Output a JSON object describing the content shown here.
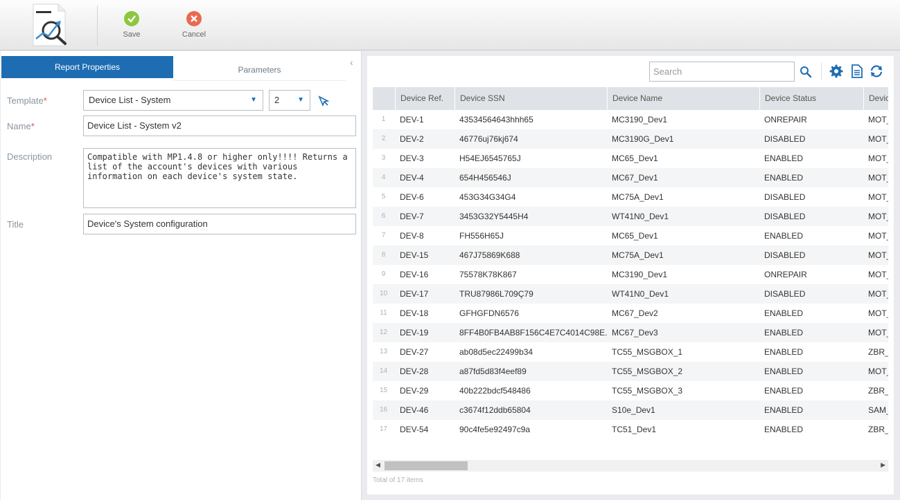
{
  "toolbar": {
    "save_label": "Save",
    "cancel_label": "Cancel",
    "save_color": "#8dc63f",
    "cancel_color": "#e76b51"
  },
  "tabs": {
    "report_properties": "Report Properties",
    "parameters": "Parameters"
  },
  "form": {
    "template_label": "Template",
    "template_value": "Device List - System",
    "version_value": "2",
    "name_label": "Name",
    "name_value": "Device List - System v2",
    "description_label": "Description",
    "description_value": "Compatible with MP1.4.8 or higher only!!!! Returns a list of the account's devices with various information on each device's system state.",
    "title_label": "Title",
    "title_value": "Device's System configuration",
    "required_mark": "*"
  },
  "search": {
    "placeholder": "Search"
  },
  "grid": {
    "columns": [
      "Device Ref.",
      "Device SSN",
      "Device Name",
      "Device Status",
      "Devic"
    ],
    "rows": [
      {
        "n": "1",
        "ref": "DEV-1",
        "ssn": "43534564643hhh65",
        "name": "MC3190_Dev1",
        "status": "ONREPAIR",
        "extra": "MOT_"
      },
      {
        "n": "2",
        "ref": "DEV-2",
        "ssn": "46776uj76kj674",
        "name": "MC3190G_Dev1",
        "status": "DISABLED",
        "extra": "MOT_"
      },
      {
        "n": "3",
        "ref": "DEV-3",
        "ssn": "H54EJ6545765J",
        "name": "MC65_Dev1",
        "status": "ENABLED",
        "extra": "MOT_"
      },
      {
        "n": "4",
        "ref": "DEV-4",
        "ssn": "654H456546J",
        "name": "MC67_Dev1",
        "status": "ENABLED",
        "extra": "MOT_"
      },
      {
        "n": "5",
        "ref": "DEV-6",
        "ssn": "453G34G34G4",
        "name": "MC75A_Dev1",
        "status": "DISABLED",
        "extra": "MOT_"
      },
      {
        "n": "6",
        "ref": "DEV-7",
        "ssn": "3453G32Y5445H4",
        "name": "WT41N0_Dev1",
        "status": "DISABLED",
        "extra": "MOT_"
      },
      {
        "n": "7",
        "ref": "DEV-8",
        "ssn": "FH556H65J",
        "name": "MC65_Dev1",
        "status": "ENABLED",
        "extra": "MOT_"
      },
      {
        "n": "8",
        "ref": "DEV-15",
        "ssn": "467J75869K688",
        "name": "MC75A_Dev1",
        "status": "DISABLED",
        "extra": "MOT_"
      },
      {
        "n": "9",
        "ref": "DEV-16",
        "ssn": "75578K78K867",
        "name": "MC3190_Dev1",
        "status": "ONREPAIR",
        "extra": "MOT_"
      },
      {
        "n": "10",
        "ref": "DEV-17",
        "ssn": "TRU87986L709Ç79",
        "name": "WT41N0_Dev1",
        "status": "DISABLED",
        "extra": "MOT_"
      },
      {
        "n": "11",
        "ref": "DEV-18",
        "ssn": "GFHGFDN6576",
        "name": "MC67_Dev2",
        "status": "ENABLED",
        "extra": "MOT_"
      },
      {
        "n": "12",
        "ref": "DEV-19",
        "ssn": "8FF4B0FB4AB8F156C4E7C4014C98E...",
        "name": "MC67_Dev3",
        "status": "ENABLED",
        "extra": "MOT_"
      },
      {
        "n": "13",
        "ref": "DEV-27",
        "ssn": "ab08d5ec22499b34",
        "name": "TC55_MSGBOX_1",
        "status": "ENABLED",
        "extra": "ZBR_"
      },
      {
        "n": "14",
        "ref": "DEV-28",
        "ssn": "a87fd5d83f4eef89",
        "name": "TC55_MSGBOX_2",
        "status": "ENABLED",
        "extra": "MOT_"
      },
      {
        "n": "15",
        "ref": "DEV-29",
        "ssn": "40b222bdcf548486",
        "name": "TC55_MSGBOX_3",
        "status": "ENABLED",
        "extra": "ZBR_"
      },
      {
        "n": "16",
        "ref": "DEV-46",
        "ssn": "c3674f12ddb65804",
        "name": "S10e_Dev1",
        "status": "ENABLED",
        "extra": "SAM_"
      },
      {
        "n": "17",
        "ref": "DEV-54",
        "ssn": "90c4fe5e92497c9a",
        "name": "TC51_Dev1",
        "status": "ENABLED",
        "extra": "ZBR_"
      }
    ]
  },
  "footer": {
    "total": "Total of 17 items"
  },
  "colors": {
    "accent": "#1e6db2"
  }
}
